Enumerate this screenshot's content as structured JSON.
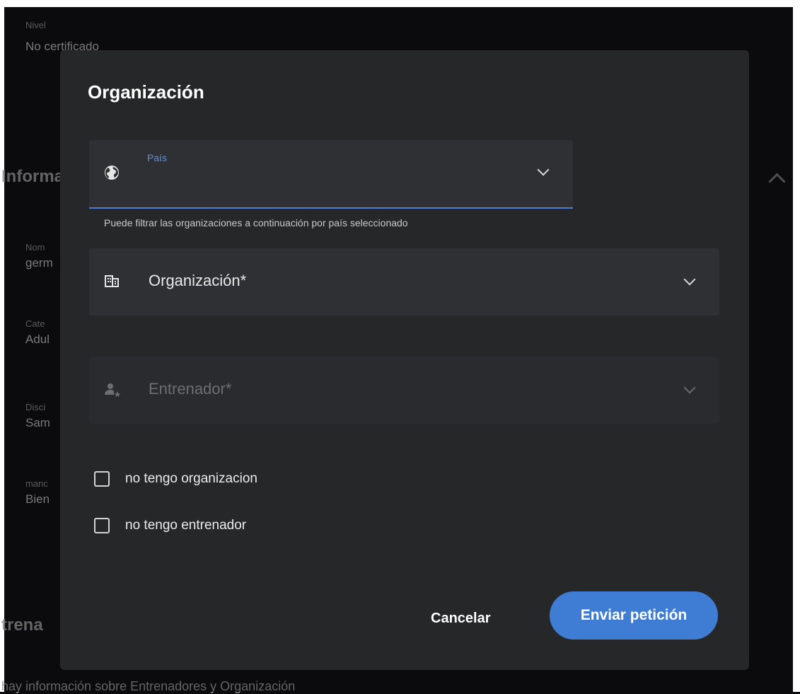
{
  "background": {
    "level_label": "Nivel",
    "level_value": "No certificado",
    "section_info": "Informa",
    "fields": [
      {
        "label": "Nom",
        "value": "germ"
      },
      {
        "label": "Cate",
        "value": "Adul"
      },
      {
        "label": "Disci",
        "value": "Sam"
      },
      {
        "label": "manc",
        "value": "Bien"
      }
    ],
    "section_trainers": "trena",
    "bottom_text": "hay información sobre Entrenadores y Organización"
  },
  "dialog": {
    "title": "Organización",
    "country_field": {
      "floating_label": "País",
      "value": "",
      "icon": "globe-icon",
      "helper_text": "Puede filtrar las organizaciones a continuación por país seleccionado"
    },
    "organization_field": {
      "label": "Organización*",
      "icon": "building-icon"
    },
    "trainer_field": {
      "label": "Entrenador*",
      "icon": "person-star-icon",
      "disabled": true
    },
    "checkboxes": [
      {
        "label": "no tengo organizacion",
        "checked": false
      },
      {
        "label": "no tengo entrenador",
        "checked": false
      }
    ],
    "cancel_label": "Cancelar",
    "submit_label": "Enviar petición"
  },
  "colors": {
    "accent": "#3f7cd4",
    "dialog_bg": "#262729",
    "field_bg": "#2f3033",
    "floating_label": "#5b8ee6"
  }
}
